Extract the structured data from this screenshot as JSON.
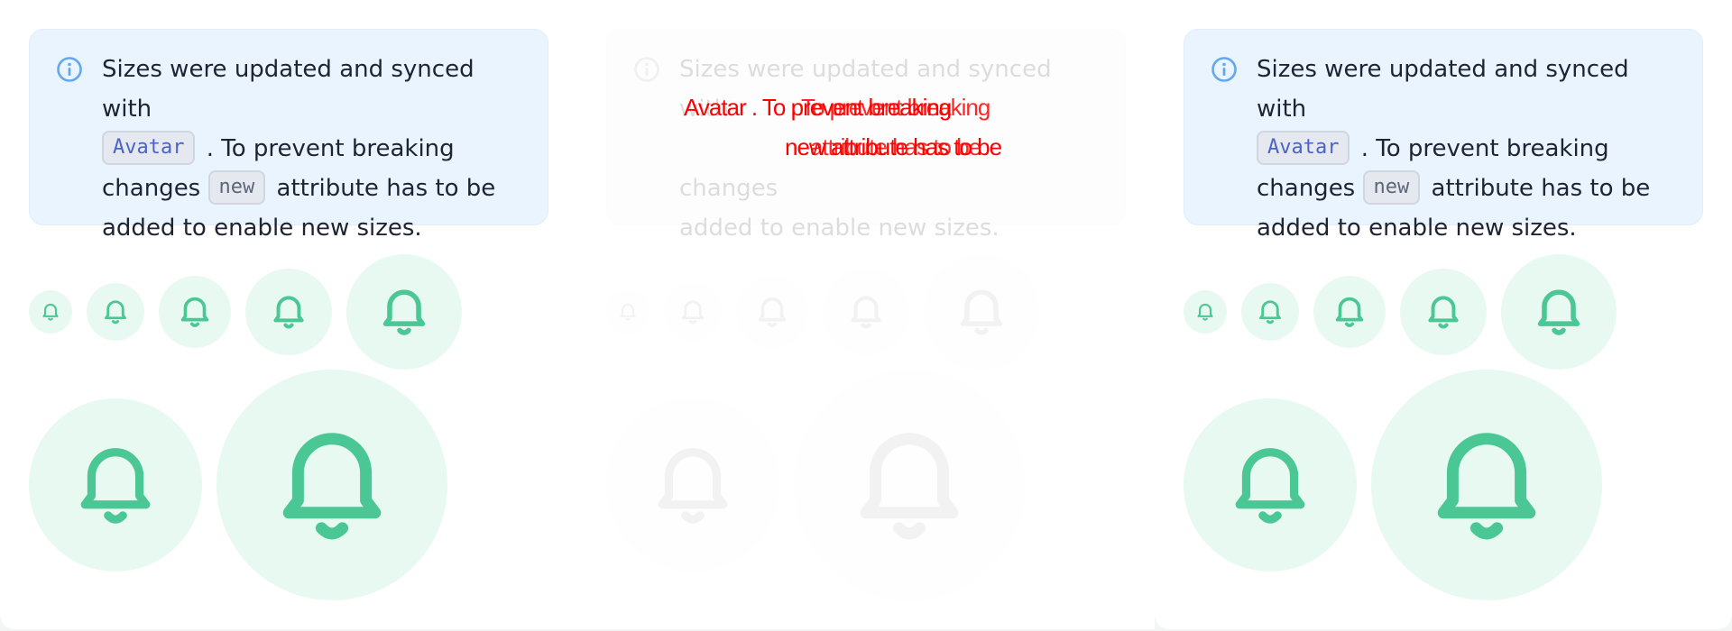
{
  "alert": {
    "icon": "info-icon",
    "line1": "Sizes were updated and synced with",
    "code1": "Avatar",
    "mid1": ". To prevent breaking",
    "pre2": "changes",
    "code2": "new",
    "mid2": "attribute has to be",
    "line4": "added to enable new sizes."
  },
  "glitch": {
    "a": "Avatar",
    "b": ". To prevent breaking",
    "c": "new",
    "d": "attribute has to be"
  },
  "avatars": {
    "icon": "bell-icon",
    "background": "#e7f9f1",
    "foreground": "#4bc796"
  },
  "colors": {
    "info_background": "#eaf4fe",
    "info_icon": "#62a8f0",
    "text": "#1e2432",
    "glitch_red": "#ff0000"
  }
}
